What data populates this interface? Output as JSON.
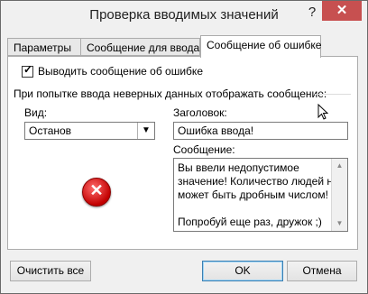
{
  "window": {
    "title": "Проверка вводимых значений",
    "help_glyph": "?",
    "close_glyph": "✕"
  },
  "tabs": [
    {
      "label": "Параметры",
      "active": false
    },
    {
      "label": "Сообщение для ввода",
      "active": false
    },
    {
      "label": "Сообщение об ошибке",
      "active": true
    }
  ],
  "panel": {
    "show_error_checkbox": {
      "label": "Выводить сообщение об ошибке",
      "checked": true
    },
    "section_text": "При попытке ввода неверных данных отображать сообщение:",
    "style": {
      "label": "Вид:",
      "value": "Останов"
    },
    "title_field": {
      "label": "Заголовок:",
      "value": "Ошибка ввода!"
    },
    "message_field": {
      "label": "Сообщение:",
      "lines": [
        "Вы ввели недопустимое",
        "значение! Количество людей не",
        "может быть дробным числом!",
        "",
        "Попробуй еще раз, дружок ;)"
      ]
    },
    "icon": "error-stop-icon"
  },
  "buttons": {
    "clear_all": "Очистить все",
    "ok": "OK",
    "cancel": "Отмена"
  },
  "colors": {
    "close_button": "#c75050",
    "error_icon": "#c20000"
  }
}
